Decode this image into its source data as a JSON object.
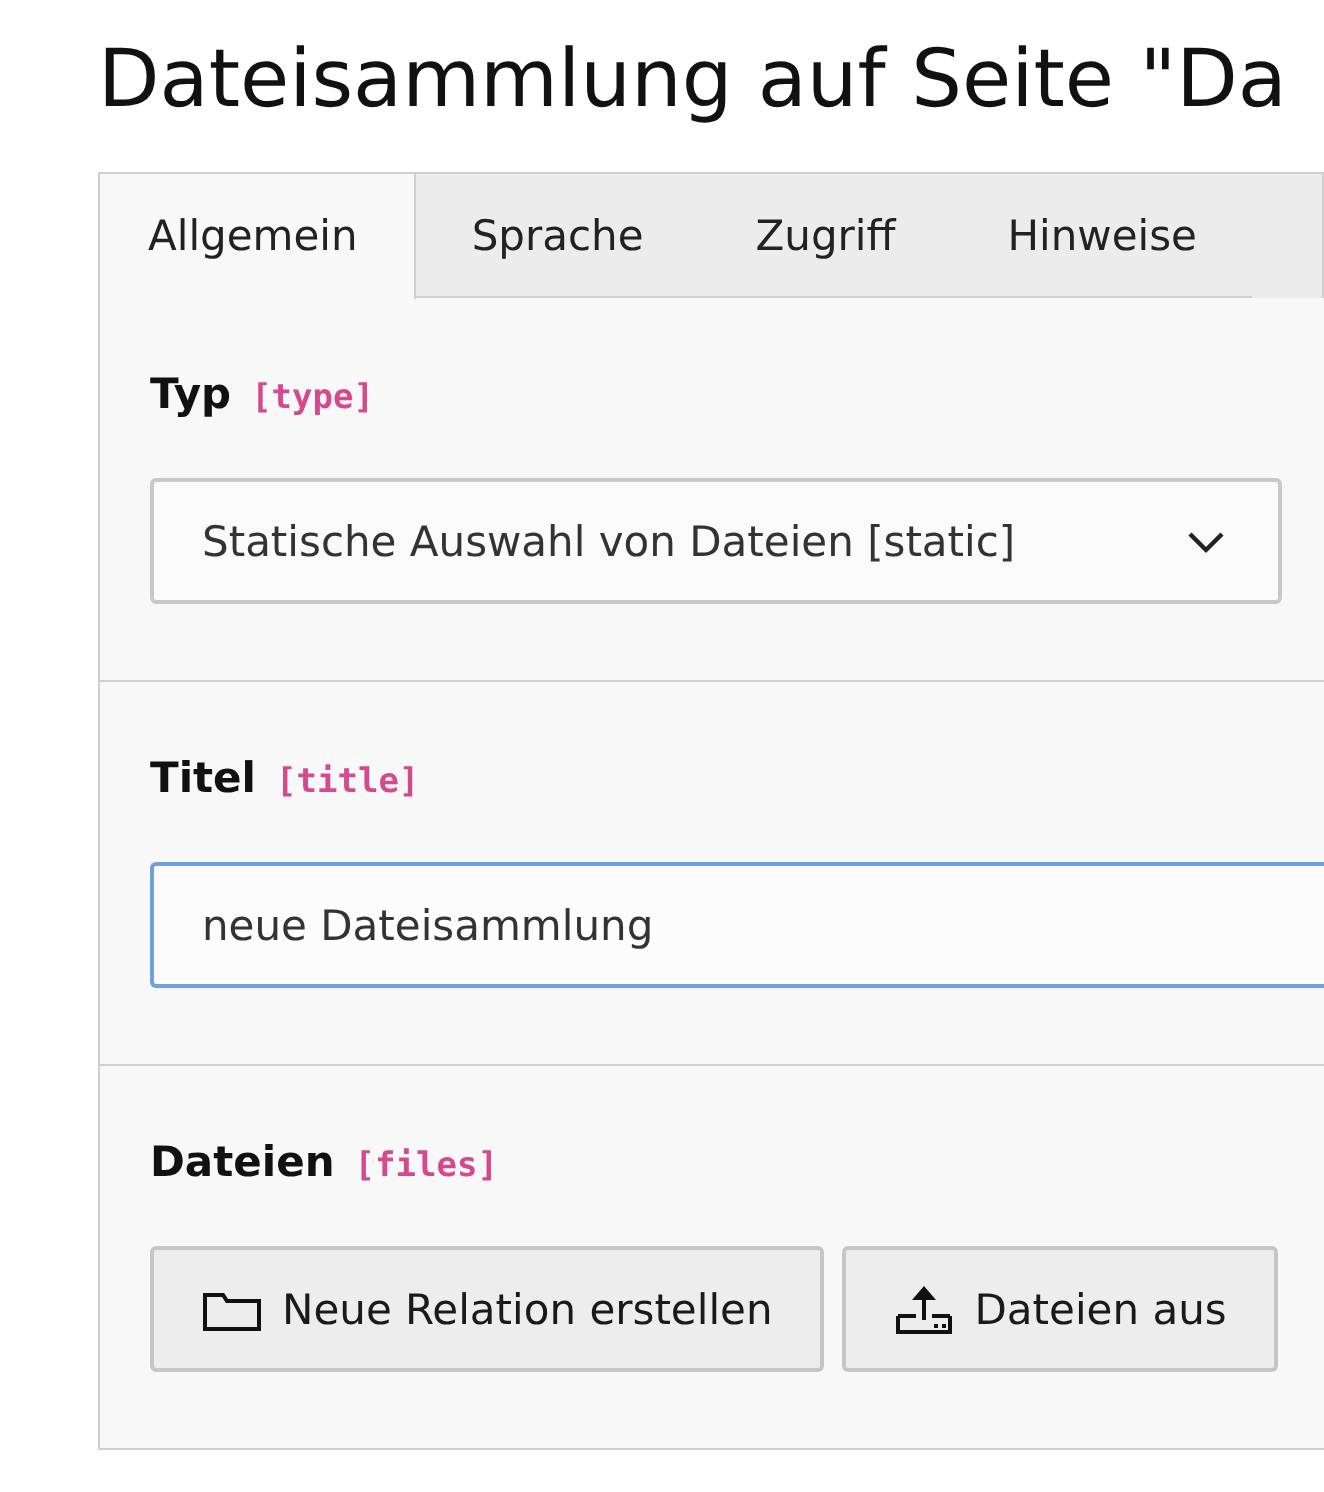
{
  "page_title": "Dateisammlung auf Seite \"Da",
  "tabs": [
    {
      "label": "Allgemein",
      "selected": true
    },
    {
      "label": "Sprache",
      "selected": false
    },
    {
      "label": "Zugriff",
      "selected": false
    },
    {
      "label": "Hinweise",
      "selected": false
    }
  ],
  "fields": [
    {
      "kind": "select",
      "label": "Typ",
      "key": "[type]",
      "value": "Statische Auswahl von Dateien [static]",
      "focused": false
    },
    {
      "kind": "text",
      "label": "Titel",
      "key": "[title]",
      "value": "neue Dateisammlung",
      "focused": true
    },
    {
      "kind": "buttons",
      "label": "Dateien",
      "key": "[files]",
      "buttons": [
        {
          "label": "Neue Relation erstellen",
          "kind": "create"
        },
        {
          "label": "Dateien aus",
          "kind": "upload"
        }
      ]
    }
  ]
}
